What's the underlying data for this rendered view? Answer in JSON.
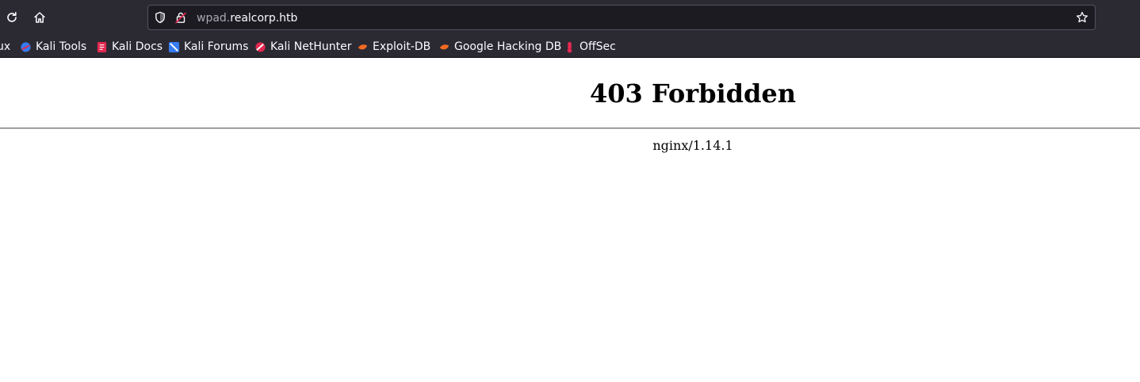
{
  "toolbar": {
    "url_prefix": "wpad.",
    "url_domain": "realcorp.htb"
  },
  "bookmarks": [
    {
      "label": "ux",
      "icon": "kali-linux-icon"
    },
    {
      "label": "Kali Tools",
      "icon": "kali-tools-icon"
    },
    {
      "label": "Kali Docs",
      "icon": "kali-docs-icon"
    },
    {
      "label": "Kali Forums",
      "icon": "kali-forums-icon"
    },
    {
      "label": "Kali NetHunter",
      "icon": "kali-nethunter-icon"
    },
    {
      "label": "Exploit-DB",
      "icon": "exploit-db-icon"
    },
    {
      "label": "Google Hacking DB",
      "icon": "exploit-db-icon"
    },
    {
      "label": "OffSec",
      "icon": "offsec-icon"
    }
  ],
  "page": {
    "title": "403 Forbidden",
    "server_signature": "nginx/1.14.1"
  },
  "colors": {
    "toolbar_bg": "#2b2a33",
    "urlbar_bg": "#1c1b22",
    "page_bg": "#ffffff",
    "insecure_lock": "#e22850"
  }
}
